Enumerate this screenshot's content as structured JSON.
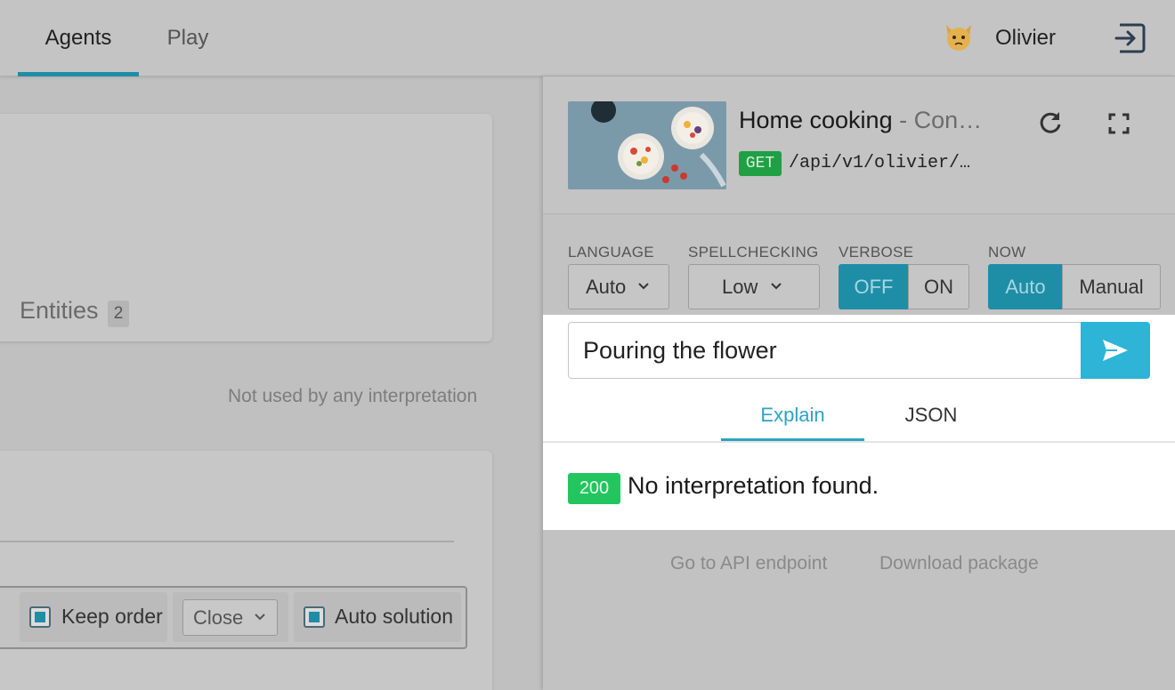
{
  "nav": {
    "tabs": [
      {
        "label": "Agents",
        "active": true
      },
      {
        "label": "Play",
        "active": false
      }
    ],
    "user": {
      "name": "Olivier",
      "avatar_icon": "cat-face-icon"
    },
    "logout_icon": "logout-icon"
  },
  "left": {
    "entities_label": "Entities",
    "entities_count": "2",
    "not_used_text": "Not used by any interpretation",
    "options": {
      "keep_order_label": "Keep order",
      "keep_order_checked": true,
      "close_select_value": "Close",
      "auto_solution_label": "Auto solution",
      "auto_solution_checked": true
    }
  },
  "console": {
    "agent_title": "Home cooking",
    "agent_subtitle": " - Con…",
    "method": "GET",
    "endpoint": "/api/v1/olivier/…",
    "options": {
      "language": {
        "label": "LANGUAGE",
        "value": "Auto"
      },
      "spellchecking": {
        "label": "SPELLCHECKING",
        "value": "Low"
      },
      "verbose": {
        "label": "VERBOSE",
        "off": "OFF",
        "on": "ON",
        "selected": "OFF"
      },
      "now": {
        "label": "NOW",
        "auto": "Auto",
        "manual": "Manual",
        "selected": "Auto"
      }
    },
    "query": "Pouring the flower",
    "tabs": [
      {
        "label": "Explain",
        "active": true
      },
      {
        "label": "JSON",
        "active": false
      }
    ],
    "status_code": "200",
    "result_text": "No interpretation found.",
    "footer_links": {
      "api": "Go to API endpoint",
      "package": "Download package"
    }
  },
  "colors": {
    "accent": "#1e8ea6",
    "send": "#2db4d7",
    "get_badge": "#1fa045",
    "ok_badge": "#22c55e"
  }
}
